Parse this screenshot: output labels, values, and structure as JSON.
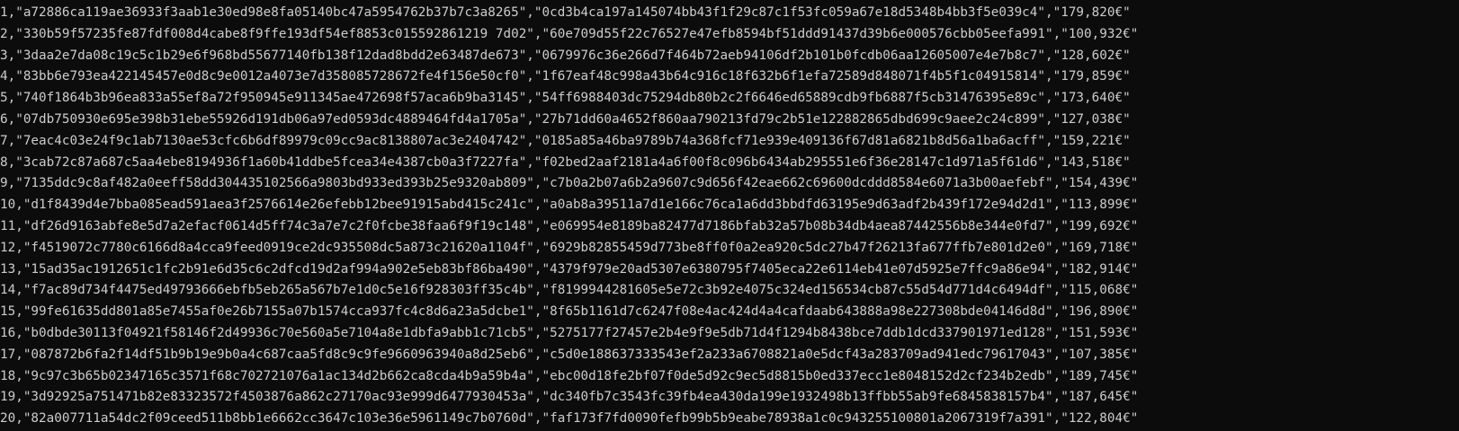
{
  "terminal": {
    "lines": [
      "1,\"a72886ca119ae36933f3aab1e30ed98e8fa05140bc47a5954762b37b7c3a8265\",\"0cd3b4ca197a145074bb43f1f29c87c1f53fc059a67e18d5348b4bb3f5e039c4\",\"179,820€\"",
      "2,\"330b59f57235fe87fdf008d4cabe8f9ffe193df54ef8853c015592861219 7d02\",\"60e709d55f22c76527e47efb8594bf51ddd91437d39b6e000576cbb05eefa991\",\"100,932€\"",
      "3,\"3daa2e7da08c19c5c1b29e6f968bd55677140fb138f12dad8bdd2e63487de673\",\"0679976c36e266d7f464b72aeb94106df2b101b0fcdb06aa12605007e4e7b8c7\",\"128,602€\"",
      "4,\"83bb6e793ea422145457e0d8c9e0012a4073e7d358085728672fe4f156e50cf0\",\"1f67eaf48c998a43b64c916c18f632b6f1efa72589d848071f4b5f1c04915814\",\"179,859€\"",
      "5,\"740f1864b3b96ea833a55ef8a72f950945e911345ae472698f57aca6b9ba3145\",\"54ff6988403dc75294db80b2c2f6646ed65889cdb9fb6887f5cb31476395e89c\",\"173,640€\"",
      "6,\"07db750930e695e398b31ebe55926d191db06a97ed0593dc4889464fd4a1705a\",\"27b71dd60a4652f860aa790213fd79c2b51e122882865dbd699c9aee2c24c899\",\"127,038€\"",
      "7,\"7eac4c03e24f9c1ab7130ae53cfc6b6df89979c09cc9ac8138807ac3e2404742\",\"0185a85a46ba9789b74a368fcf71e939e409136f67d81a6821b8d56a1ba6acff\",\"159,221€\"",
      "8,\"3cab72c87a687c5aa4ebe8194936f1a60b41ddbe5fcea34e4387cb0a3f7227fa\",\"f02bed2aaf2181a4a6f00f8c096b6434ab295551e6f36e28147c1d971a5f61d6\",\"143,518€\"",
      "9,\"7135ddc9c8af482a0eeff58dd304435102566a9803bd933ed393b25e9320ab809\",\"c7b0a2b07a6b2a9607c9d656f42eae662c69600dcddd8584e6071a3b00aefebf\",\"154,439€\"",
      "10,\"d1f8439d4e7bba085ead591aea3f2576614e26efebb12bee91915abd415c241c\",\"a0ab8a39511a7d1e166c76ca1a6dd3bbdfd63195e9d63adf2b439f172e94d2d1\",\"113,899€\"",
      "11,\"df26d9163abfe8e5d7a2efacf0614d5ff74c3a7e7c2f0fcbe38faa6f9f19c148\",\"e069954e8189ba82477d7186bfab32a57b08b34db4aea87442556b8e344e0fd7\",\"199,692€\"",
      "12,\"f4519072c7780c6166d8a4cca9feed0919ce2dc935508dc5a873c21620a1104f\",\"6929b82855459d773be8ff0f0a2ea920c5dc27b47f26213fa677ffb7e801d2e0\",\"169,718€\"",
      "13,\"15ad35ac1912651c1fc2b91e6d35c6c2dfcd19d2af994a902e5eb83bf86ba490\",\"4379f979e20ad5307e6380795f7405eca22e6114eb41e07d5925e7ffc9a86e94\",\"182,914€\"",
      "14,\"f7ac89d734f4475ed49793666ebfb5eb265a567b7e1d0c5e16f928303ff35c4b\",\"f8199944281605e5e72c3b92e4075c324ed156534cb87c55d54d771d4c6494df\",\"115,068€\"",
      "15,\"99fe61635dd801a85e7455af0e26b7155a07b1574cca937fc4c8d6a23a5dcbe1\",\"8f65b1161d7c6247f08e4ac424d4a4cafdaab643888a98e227308bde04146d8d\",\"196,890€\"",
      "16,\"b0dbde30113f04921f58146f2d49936c70e560a5e7104a8e1dbfa9abb1c71cb5\",\"5275177f27457e2b4e9f9e5db71d4f1294b8438bce7ddb1dcd337901971ed128\",\"151,593€\"",
      "17,\"087872b6fa2f14df51b9b19e9b0a4c687caa5fd8c9c9fe9660963940a8d25eb6\",\"c5d0e188637333543ef2a233a6708821a0e5dcf43a283709ad941edc79617043\",\"107,385€\"",
      "18,\"9c97c3b65b02347165c3571f68c702721076a1ac134d2b662ca8cda4b9a59b4a\",\"ebc00d18fe2bf07f0de5d92c9ec5d8815b0ed337ecc1e8048152d2cf234b2edb\",\"189,745€\"",
      "19,\"3d92925a751471b82e83323572f4503876a862c27170ac93e999d6477930453a\",\"dc340fb7c3543fc39fb4ea430da199e1932498b13ffbb55ab9fe6845838157b4\",\"187,645€\"",
      "20,\"82a007711a54dc2f09ceed511b8bb1e6662cc3647c103e36e5961149c7b0760d\",\"faf173f7fd0090fefb99b5b9eabe78938a1c0c943255100801a2067319f7a391\",\"122,804€\""
    ]
  }
}
